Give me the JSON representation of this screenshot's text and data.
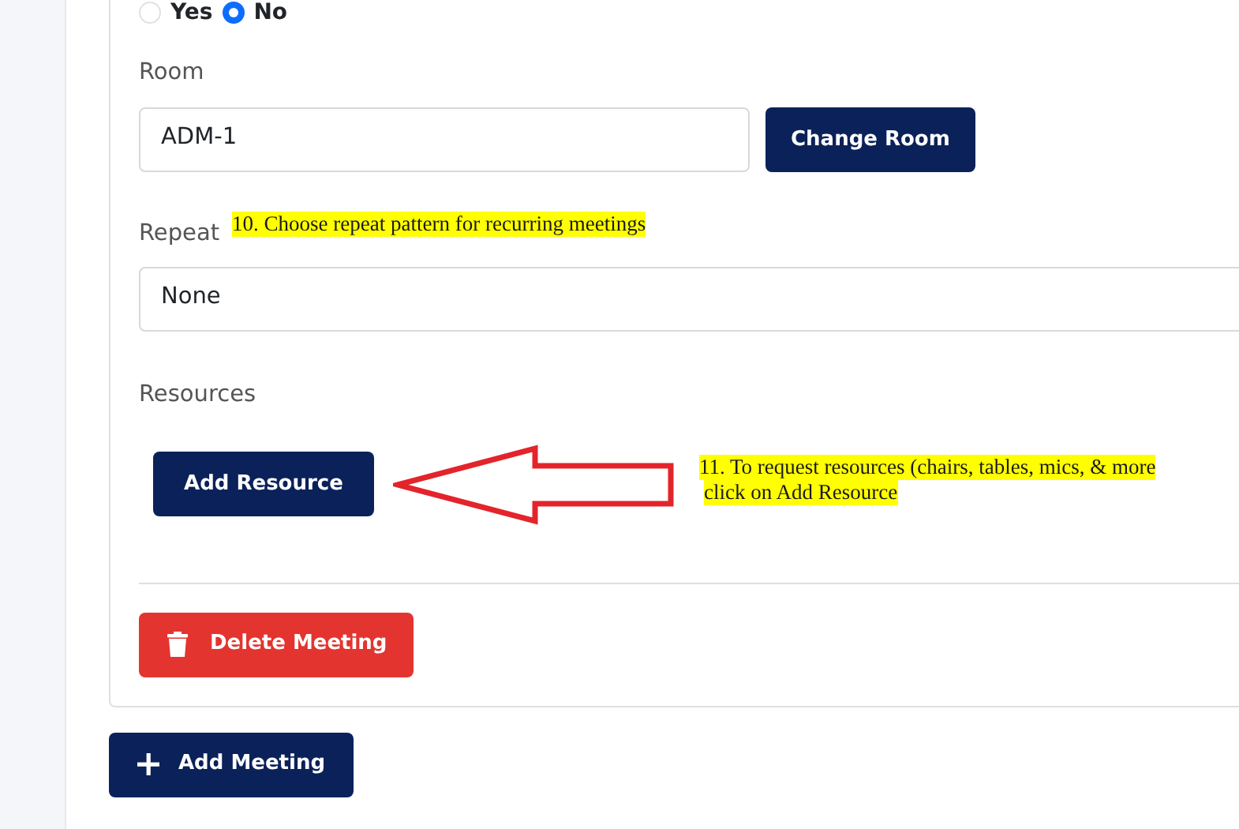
{
  "radio_options": [
    {
      "label": "Yes",
      "selected": false
    },
    {
      "label": "No",
      "selected": true
    }
  ],
  "room": {
    "label": "Room",
    "value": "ADM-1",
    "button": "Change Room"
  },
  "repeat": {
    "label": "Repeat",
    "value": "None",
    "callout": "10. Choose repeat pattern for recurring meetings"
  },
  "resources": {
    "label": "Resources",
    "button": "Add Resource",
    "callout_lines": [
      "11. To request resources (chairs, tables, mics, & more",
      "click on Add Resource"
    ]
  },
  "delete_button": "Delete Meeting",
  "add_meeting_button": "Add Meeting"
}
